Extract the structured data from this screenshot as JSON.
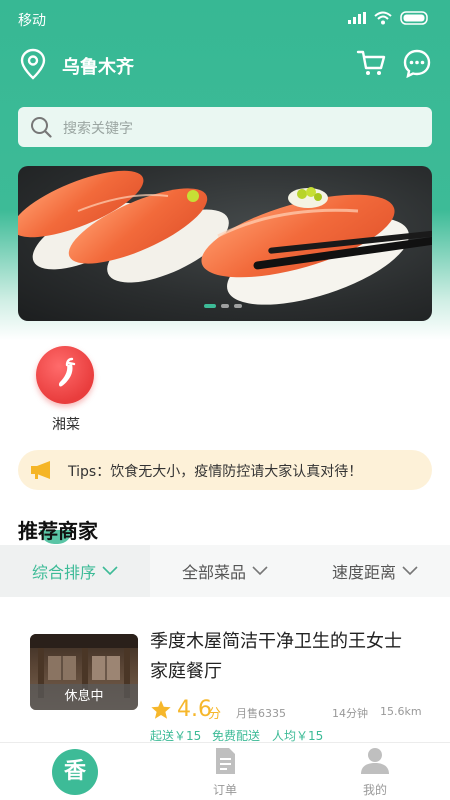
{
  "status": {
    "carrier": "移动"
  },
  "header": {
    "city": "乌鲁木齐"
  },
  "search": {
    "placeholder": "搜索关键字"
  },
  "banner": {
    "dots": 3,
    "active_dot": 0
  },
  "categories": [
    {
      "label": "湘菜",
      "icon": "chili-pepper-icon"
    }
  ],
  "tips": {
    "text": "Tips：饮食无大小，疫情防控请大家认真对待！"
  },
  "section": {
    "title": "推荐商家"
  },
  "sort": {
    "items": [
      {
        "label": "综合排序",
        "active": true
      },
      {
        "label": "全部菜品",
        "active": false
      },
      {
        "label": "速度距离",
        "active": false
      }
    ]
  },
  "shops": [
    {
      "name": "季度木屋简洁干净卫生的王女士家庭餐厅",
      "status": "休息中",
      "rating": "4.6",
      "rating_unit": "分",
      "monthly_sales": "月售6335",
      "time": "14分钟",
      "distance": "15.6km",
      "min_order": "起送￥15",
      "delivery_fee": "免费配送",
      "per_person": "人均￥15"
    }
  ],
  "tabbar": {
    "home_glyph": "香",
    "items": [
      {
        "label": "订单",
        "icon": "order-icon"
      },
      {
        "label": "我的",
        "icon": "user-icon"
      }
    ]
  },
  "colors": {
    "primary": "#3dbb97",
    "tips_bg": "#fdf1d8",
    "rating": "#f6b72b",
    "category": "#e93d3d"
  }
}
